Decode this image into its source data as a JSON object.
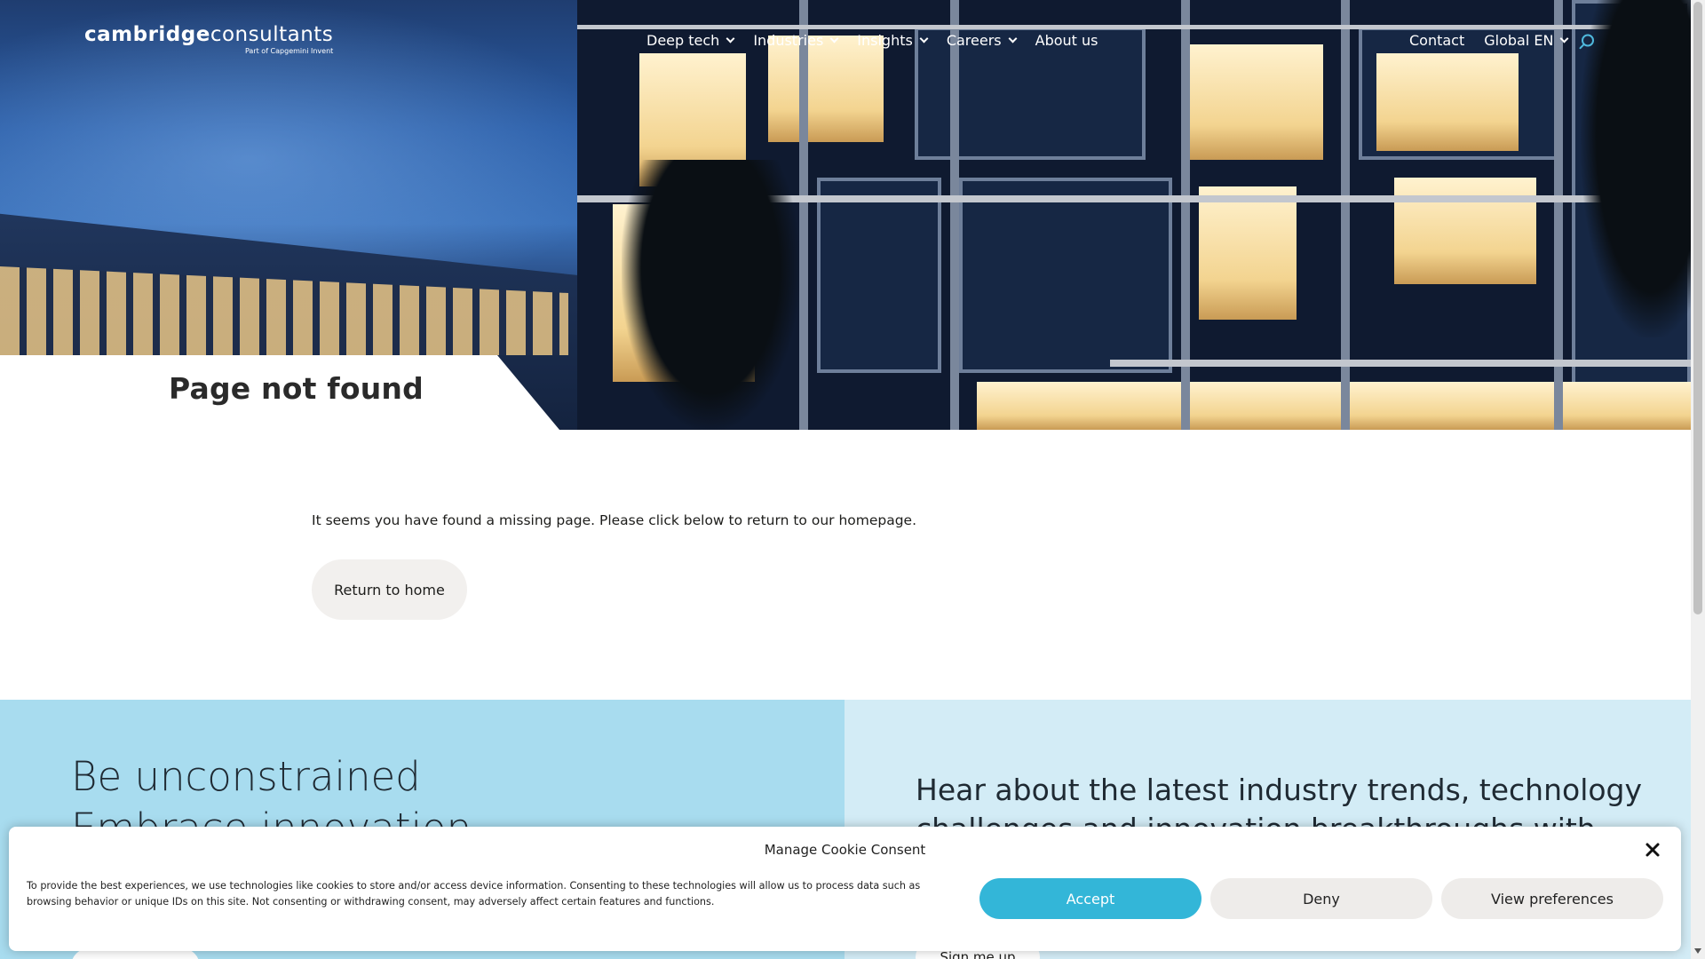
{
  "header": {
    "logo": {
      "brand_bold": "cambridge",
      "brand_light": "consultants",
      "sub": "Part of Capgemini Invent"
    },
    "nav": [
      {
        "label": "Deep tech",
        "dropdown": true
      },
      {
        "label": "Industries",
        "dropdown": true
      },
      {
        "label": "Insights",
        "dropdown": true
      },
      {
        "label": "Careers",
        "dropdown": true
      },
      {
        "label": "About us",
        "dropdown": false
      }
    ],
    "right": {
      "contact": "Contact",
      "locale": "Global EN"
    },
    "search_icon": "search-icon"
  },
  "hero": {
    "title": "Page not found"
  },
  "main": {
    "message": "It seems you have found a missing page. Please click below to return to our homepage.",
    "home_button": "Return to home"
  },
  "bands": {
    "left_heading_line1": "Be unconstrained",
    "left_heading_line2": "Embrace innovation",
    "right_text": "Hear about the latest industry trends, technology challenges and innovation breakthroughs with our",
    "signup_button": "Sign me up"
  },
  "cookie": {
    "title": "Manage Cookie Consent",
    "text": "To provide the best experiences, we use technologies like cookies to store and/or access device information. Consenting to these technologies will allow us to process data such as browsing behavior or unique IDs on this site. Not consenting or withdrawing consent, may adversely affect certain features and functions.",
    "accept": "Accept",
    "deny": "Deny",
    "preferences": "View preferences",
    "accent": "#33b6d8"
  }
}
